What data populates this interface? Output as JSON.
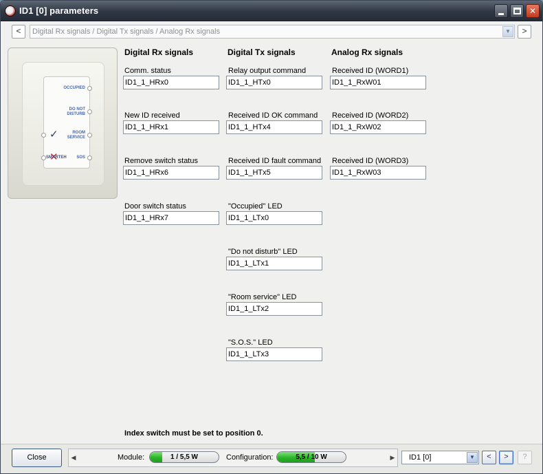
{
  "window": {
    "title": "ID1 [0] parameters"
  },
  "nav": {
    "breadcrumb": "Digital Rx signals / Digital Tx signals / Analog Rx signals",
    "prev": "<",
    "next": ">"
  },
  "device": {
    "labels": [
      "OCCUPIED",
      "DO NOT DISTURB",
      "ROOM SERVICE",
      "SOS"
    ],
    "logo": "SMARTEH"
  },
  "columns": [
    {
      "heading": "Digital Rx signals",
      "fields": [
        {
          "label": "Comm. status",
          "value": "ID1_1_HRx0"
        },
        {
          "label": "New ID received",
          "value": "ID1_1_HRx1"
        },
        {
          "label": "Remove switch status",
          "value": "ID1_1_HRx6"
        },
        {
          "label": "Door switch status",
          "value": "ID1_1_HRx7"
        }
      ]
    },
    {
      "heading": "Digital Tx signals",
      "fields": [
        {
          "label": "Relay output command",
          "value": "ID1_1_HTx0"
        },
        {
          "label": "Received ID OK command",
          "value": "ID1_1_HTx4"
        },
        {
          "label": "Received ID fault command",
          "value": "ID1_1_HTx5"
        },
        {
          "label": "\"Occupied\" LED",
          "value": "ID1_1_LTx0"
        },
        {
          "label": "\"Do not disturb\" LED",
          "value": "ID1_1_LTx1"
        },
        {
          "label": "\"Room service\" LED",
          "value": "ID1_1_LTx2"
        },
        {
          "label": "\"S.O.S.\" LED",
          "value": "ID1_1_LTx3"
        }
      ]
    },
    {
      "heading": "Analog Rx signals",
      "fields": [
        {
          "label": "Received ID (WORD1)",
          "value": "ID1_1_RxW01"
        },
        {
          "label": "Received ID (WORD2)",
          "value": "ID1_1_RxW02"
        },
        {
          "label": "Received ID (WORD3)",
          "value": "ID1_1_RxW03"
        }
      ]
    }
  ],
  "note": "Index switch must be set to position 0.",
  "statusbar": {
    "close_label": "Close",
    "module": {
      "label": "Module:",
      "text": "1 / 5,5 W",
      "fraction": 0.18
    },
    "configuration": {
      "label": "Configuration:",
      "text": "5,5 / 10 W",
      "fraction": 0.55
    },
    "selector_value": "ID1 [0]",
    "prev": "<",
    "next": ">",
    "help": "?"
  },
  "colors": {
    "accent_green": "#2cb52a",
    "label_blue": "#4a67a6"
  }
}
